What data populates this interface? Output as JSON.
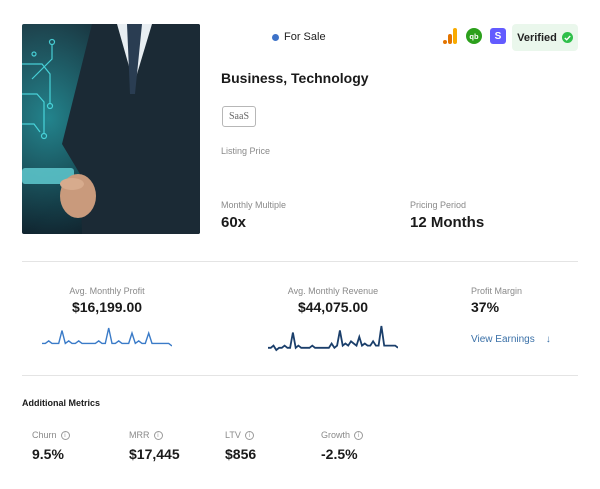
{
  "listing": {
    "status": "For Sale",
    "verified_label": "Verified",
    "title": "Business, Technology",
    "tag": "SaaS",
    "listing_price_label": "Listing Price",
    "monthly_multiple_label": "Monthly Multiple",
    "monthly_multiple_value": "60x",
    "pricing_period_label": "Pricing Period",
    "pricing_period_value": "12 Months"
  },
  "integrations": [
    "google-analytics-icon",
    "quickbooks-icon",
    "stripe-icon"
  ],
  "integration_glyphs": {
    "quickbooks": "qb",
    "stripe": "S"
  },
  "stats": {
    "profit_label": "Avg. Monthly Profit",
    "profit_value": "$16,199.00",
    "revenue_label": "Avg. Monthly Revenue",
    "revenue_value": "$44,075.00",
    "margin_label": "Profit Margin",
    "margin_value": "37%",
    "view_earnings": "View Earnings",
    "arrow": "↓"
  },
  "sparklines": {
    "profit": [
      3,
      3,
      4,
      3,
      3,
      3,
      8,
      3,
      4,
      3,
      3,
      4,
      3,
      3,
      3,
      3,
      3,
      4,
      3,
      3,
      9,
      3,
      3,
      4,
      3,
      3,
      3,
      7,
      3,
      4,
      3,
      3,
      7,
      3,
      3,
      3,
      3,
      3,
      3,
      2
    ],
    "revenue": [
      3,
      3,
      4,
      2,
      3,
      3,
      4,
      3,
      3,
      10,
      3,
      4,
      3,
      3,
      3,
      3,
      4,
      3,
      3,
      3,
      3,
      3,
      3,
      5,
      3,
      4,
      11,
      4,
      5,
      4,
      6,
      5,
      4,
      8,
      4,
      5,
      4,
      4,
      6,
      4,
      4,
      13,
      4,
      4,
      4,
      4,
      4,
      3
    ]
  },
  "additional_metrics": {
    "title": "Additional Metrics",
    "items": [
      {
        "label": "Churn",
        "value": "9.5%"
      },
      {
        "label": "MRR",
        "value": "$17,445"
      },
      {
        "label": "LTV",
        "value": "$856"
      },
      {
        "label": "Growth",
        "value": "-2.5%"
      }
    ]
  },
  "colors": {
    "status_dot": "#3d72c8",
    "verified_bg": "#eaf7ec",
    "verified_check": "#2fbf4a",
    "profit_line": "#3a7bc8",
    "revenue_line": "#1b3f6b",
    "link": "#3b71a8"
  }
}
